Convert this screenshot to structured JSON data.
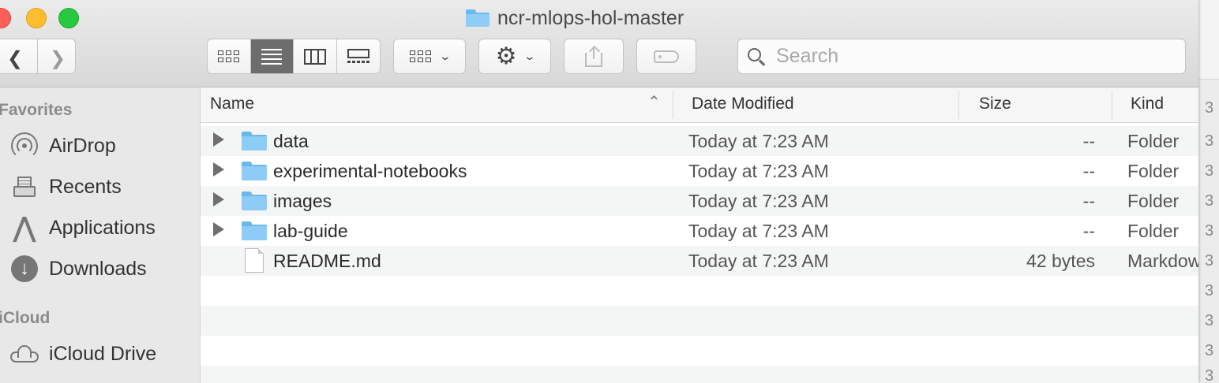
{
  "window": {
    "title": "ncr-mlops-hol-master",
    "title_icon": "folder-icon"
  },
  "toolbar": {
    "back_icon": "chevron-left-icon",
    "forward_icon": "chevron-right-icon",
    "view_modes": [
      "icon-view",
      "list-view",
      "column-view",
      "gallery-view"
    ],
    "active_view": "list-view",
    "search_placeholder": "Search"
  },
  "sidebar": {
    "favorites_heading": "Favorites",
    "favorites": [
      {
        "label": "AirDrop",
        "icon": "airdrop-icon"
      },
      {
        "label": "Recents",
        "icon": "recents-icon"
      },
      {
        "label": "Applications",
        "icon": "applications-icon"
      },
      {
        "label": "Downloads",
        "icon": "downloads-icon"
      }
    ],
    "icloud_heading": "iCloud",
    "icloud": [
      {
        "label": "iCloud Drive",
        "icon": "cloud-icon"
      }
    ]
  },
  "columns": {
    "name": "Name",
    "date": "Date Modified",
    "size": "Size",
    "kind": "Kind"
  },
  "files": [
    {
      "name": "data",
      "date": "Today at 7:23 AM",
      "size": "--",
      "kind": "Folder",
      "type": "folder"
    },
    {
      "name": "experimental-notebooks",
      "date": "Today at 7:23 AM",
      "size": "--",
      "kind": "Folder",
      "type": "folder"
    },
    {
      "name": "images",
      "date": "Today at 7:23 AM",
      "size": "--",
      "kind": "Folder",
      "type": "folder"
    },
    {
      "name": "lab-guide",
      "date": "Today at 7:23 AM",
      "size": "--",
      "kind": "Folder",
      "type": "folder"
    },
    {
      "name": "README.md",
      "date": "Today at 7:23 AM",
      "size": "42 bytes",
      "kind": "Markdow",
      "type": "file"
    }
  ],
  "background_window": {
    "column_glyph": "3"
  },
  "colors": {
    "folder_blue": "#8dccf6",
    "close": "#fd5f57",
    "minimize": "#febc2e",
    "maximize": "#28c840"
  }
}
